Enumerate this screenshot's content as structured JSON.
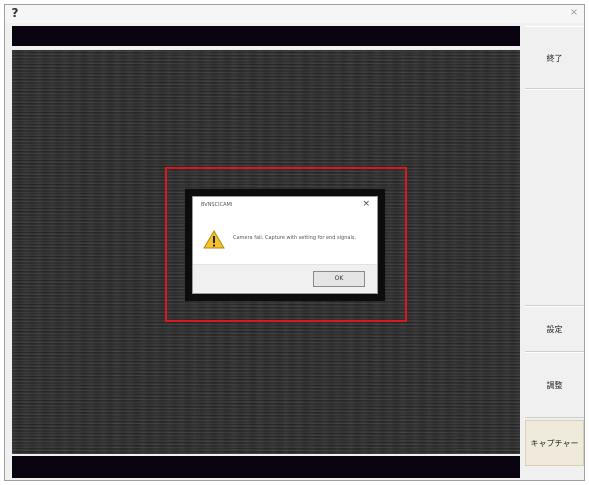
{
  "window": {
    "help_icon": "?",
    "close_icon": "×"
  },
  "dialog": {
    "title": "BVNSCICAMI",
    "close_icon": "×",
    "message": "Camera fail. Capture with setting for end signals.",
    "ok_label": "OK",
    "icon": "warning-icon"
  },
  "side_buttons": {
    "exit_label": "終了",
    "settings_label": "設定",
    "adjust_label": "調整",
    "capture_label": "キャプチャー"
  },
  "colors": {
    "highlight": "#d8191e",
    "bars": "#0a0410",
    "capture_active": "#efeadc"
  }
}
